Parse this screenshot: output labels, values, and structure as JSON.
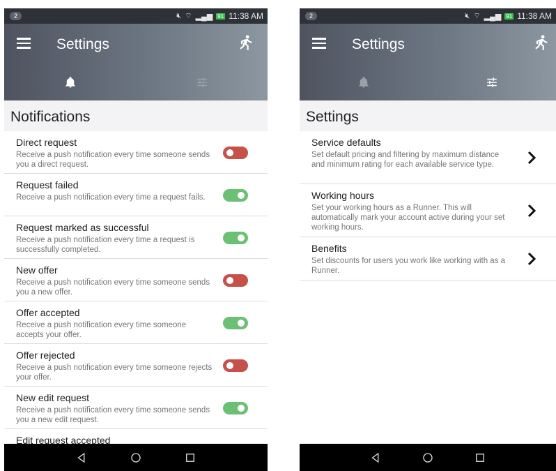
{
  "left": {
    "status": {
      "badge": "2",
      "battery": "91",
      "time": "11:38 AM"
    },
    "appbar": {
      "title": "Settings"
    },
    "section_title": "Notifications",
    "rows": [
      {
        "title": "Direct request",
        "desc": "Receive a push notification every time someone sends you a direct request.",
        "enabled": false
      },
      {
        "title": "Request failed",
        "desc": "Receive a push notification every time a request fails.",
        "enabled": true
      },
      {
        "title": "Request marked as successful",
        "desc": "Receive a push notification every time a request is successfully completed.",
        "enabled": true
      },
      {
        "title": "New offer",
        "desc": "Receive a push notification every time someone sends you a new offer.",
        "enabled": false
      },
      {
        "title": "Offer accepted",
        "desc": "Receive a push notification every time someone accepts your offer.",
        "enabled": true
      },
      {
        "title": "Offer rejected",
        "desc": "Receive a push notification every time someone rejects your offer.",
        "enabled": false
      },
      {
        "title": "New edit request",
        "desc": "Receive a push notification every time someone sends you a new edit request.",
        "enabled": true
      },
      {
        "title": "Edit request accepted",
        "desc": "",
        "enabled": true
      }
    ]
  },
  "right": {
    "status": {
      "badge": "2",
      "battery": "91",
      "time": "11:38 AM"
    },
    "appbar": {
      "title": "Settings"
    },
    "section_title": "Settings",
    "rows": [
      {
        "title": "Service defaults",
        "desc": "Set default pricing and filtering by maximum distance and minimum rating for each available service type."
      },
      {
        "title": "Working hours",
        "desc": "Set your working hours as a Runner. This will automatically mark your account active during your set working hours."
      },
      {
        "title": "Benefits",
        "desc": "Set discounts for users you work like working with as a Runner."
      }
    ]
  },
  "colors": {
    "toggle_on": "#6cc073",
    "toggle_off": "#c6504a",
    "appbar_start": "#4f5360",
    "appbar_end": "#8c97a1"
  },
  "icons": {
    "menu": "hamburger-icon",
    "runner": "running-person-icon",
    "tab_notifications": "bell-icon",
    "tab_settings": "sliders-icon",
    "chevron": "chevron-right-icon",
    "nav_back": "triangle-back-icon",
    "nav_home": "circle-home-icon",
    "nav_recent": "square-recent-icon"
  }
}
